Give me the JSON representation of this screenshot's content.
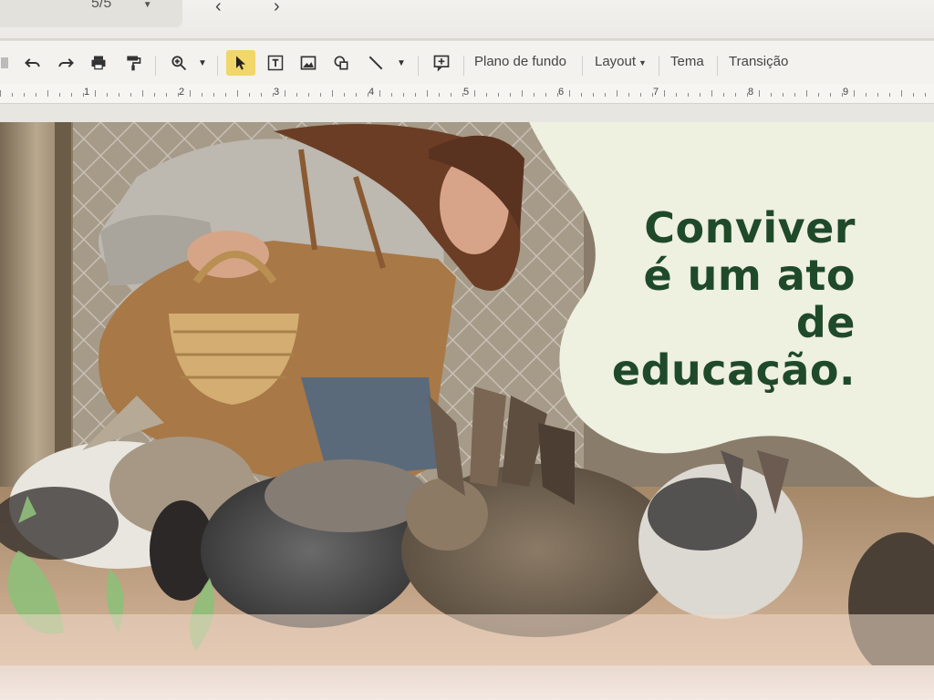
{
  "topbar": {
    "slide_counter": "5/5",
    "prev_icon": "chevron-left-icon",
    "next_icon": "chevron-right-icon"
  },
  "toolbar": {
    "icons": [
      "undo-icon",
      "redo-icon",
      "print-icon",
      "paint-format-icon",
      "zoom-icon",
      "select-cursor-icon",
      "text-box-icon",
      "image-icon",
      "shape-icon",
      "line-icon",
      "add-comment-icon"
    ],
    "background_label": "Plano de fundo",
    "layout_label": "Layout",
    "theme_label": "Tema",
    "transition_label": "Transição"
  },
  "ruler": {
    "numbers": [
      "1",
      "2",
      "3",
      "4",
      "5",
      "6",
      "7",
      "8",
      "9"
    ]
  },
  "slide": {
    "headline_lines": [
      "Conviver",
      "é um ato",
      "de",
      "educação."
    ],
    "headline_color": "#1f4a2a",
    "panel_color": "#eef0e0",
    "leaf_color": "#8fbf7a"
  }
}
